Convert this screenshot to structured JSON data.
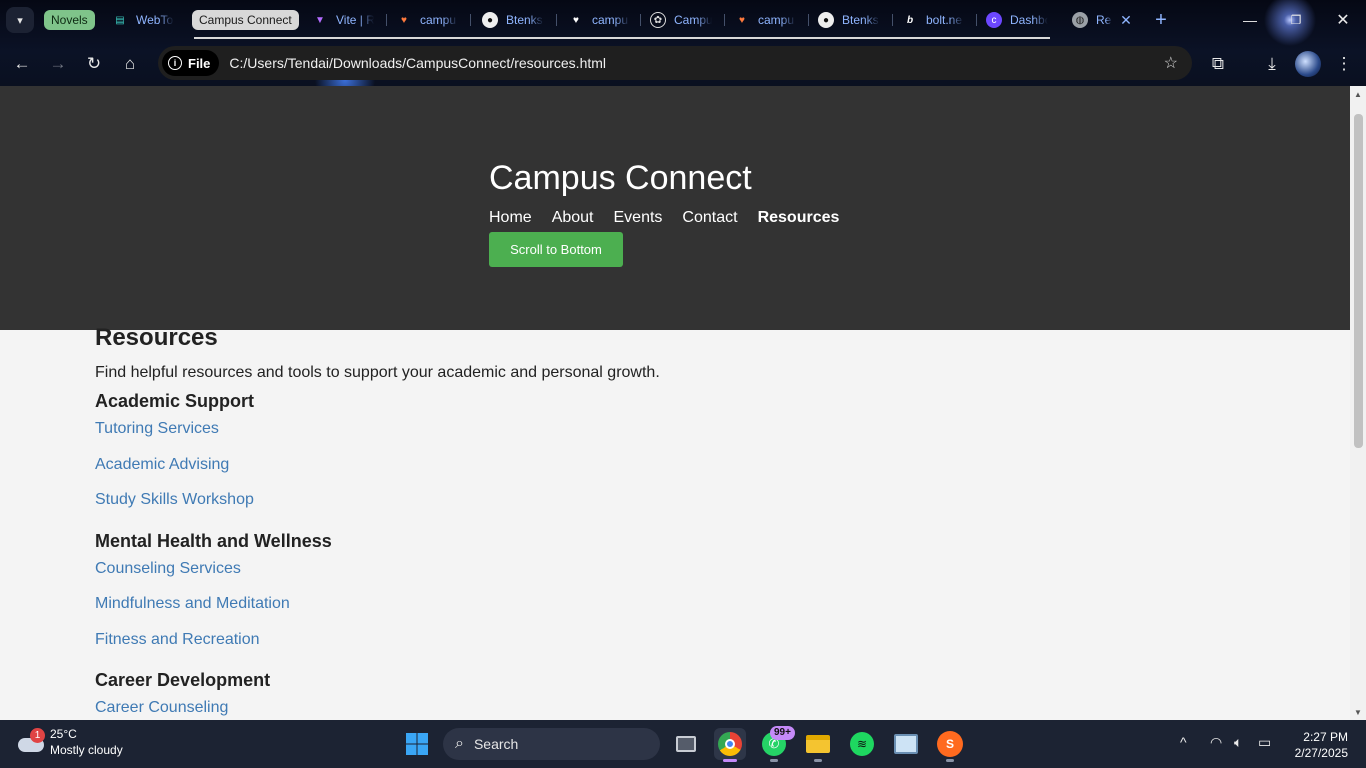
{
  "browser": {
    "tab_groups": [
      {
        "label": "Novels",
        "color": "#7fc48a"
      },
      {
        "label": "Campus Connect",
        "color": "#d8d8d8"
      }
    ],
    "tabs": [
      {
        "label": "WebTo",
        "icon": "book-icon"
      },
      {
        "label": "Vite | R",
        "icon": "vite-icon"
      },
      {
        "label": "campu",
        "icon": "heart-icon"
      },
      {
        "label": "Btenks",
        "icon": "github-icon"
      },
      {
        "label": "campu",
        "icon": "heart-outline-icon"
      },
      {
        "label": "Campu",
        "icon": "openai-icon"
      },
      {
        "label": "campu",
        "icon": "heart-icon"
      },
      {
        "label": "Btenks",
        "icon": "github-icon"
      },
      {
        "label": "bolt.ne",
        "icon": "bolt-icon"
      },
      {
        "label": "Dashbo",
        "icon": "clerk-icon"
      },
      {
        "label": "Re",
        "icon": "globe-icon"
      }
    ],
    "site_chip": "File",
    "url": "C:/Users/Tendai/Downloads/CampusConnect/resources.html"
  },
  "site": {
    "title": "Campus Connect",
    "nav": [
      "Home",
      "About",
      "Events",
      "Contact",
      "Resources"
    ],
    "active_nav": "Resources",
    "scroll_button": "Scroll to Bottom",
    "accent": "#4caf50",
    "header_bg": "#333333",
    "link_color": "#3f7ab4"
  },
  "page": {
    "heading": "Resources",
    "intro": "Find helpful resources and tools to support your academic and personal growth.",
    "sections": [
      {
        "title": "Academic Support",
        "links": [
          "Tutoring Services",
          "Academic Advising",
          "Study Skills Workshop"
        ]
      },
      {
        "title": "Mental Health and Wellness",
        "links": [
          "Counseling Services",
          "Mindfulness and Meditation",
          "Fitness and Recreation"
        ]
      },
      {
        "title": "Career Development",
        "links": [
          "Career Counseling"
        ]
      }
    ]
  },
  "taskbar": {
    "weather_temp": "25°C",
    "weather_desc": "Mostly cloudy",
    "weather_badge": "1",
    "search_label": "Search",
    "whatsapp_badge": "99+",
    "time": "2:27 PM",
    "date": "2/27/2025"
  }
}
